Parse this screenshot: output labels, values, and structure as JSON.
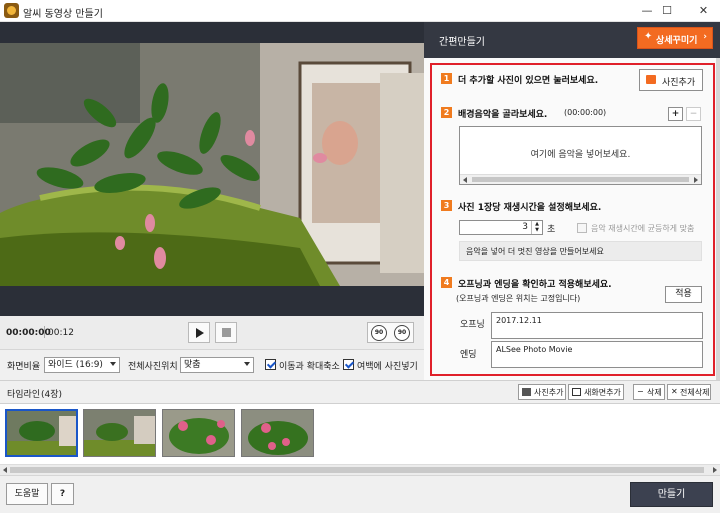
{
  "window": {
    "title": "알씨 동영상 만들기",
    "controls": [
      "—",
      "☐",
      "✕"
    ]
  },
  "player": {
    "current_time": "00:00:00",
    "total_time": "00:12",
    "rotate_left": "90",
    "rotate_right": "90"
  },
  "options": {
    "aspect_label": "화면비율",
    "aspect_value": "와이드 (16:9)",
    "position_label": "전체사진위치",
    "position_value": "맞춤",
    "motion_label": "이동과 확대축소",
    "margin_label": "여백에 사진넣기",
    "motion_checked": true,
    "margin_checked": true
  },
  "panel": {
    "title": "간편만들기",
    "detail_button": "상세꾸미기",
    "step1": {
      "num": "1",
      "text": "더 추가할 사진이 있으면 눌러보세요.",
      "button": "사진추가"
    },
    "step2": {
      "num": "2",
      "text": "배경음악을 골라보세요.",
      "time": "(00:00:00)",
      "plus": "+",
      "minus": "−",
      "placeholder": "여기에 음악을 넣어보세요."
    },
    "step3": {
      "num": "3",
      "text": "사진 1장당 재생시간을 설정해보세요.",
      "seconds": "3",
      "unit": "초",
      "fit_music": "음악 재생시간에 균등하게 맞춤",
      "hint": "음악을 넣어 더 멋진 영상을 만들어보세요"
    },
    "step4": {
      "num": "4",
      "text": "오프닝과 엔딩을 확인하고 적용해보세요.",
      "note": "(오프닝과 엔딩은 위치는 고정입니다)",
      "apply": "적용",
      "opening_label": "오프닝",
      "opening_value": "2017.12.11",
      "ending_label": "엔딩",
      "ending_value": "ALSee Photo Movie"
    }
  },
  "timeline": {
    "title": "타임라인",
    "count": "(4장)",
    "add_photo": "사진추가",
    "new_scene": "새화면추가",
    "delete": "삭제",
    "delete_all": "전체삭제",
    "delete_icon": "−",
    "delete_all_icon": "✕"
  },
  "footer": {
    "help": "도움말",
    "question": "?",
    "make": "만들기"
  },
  "colors": {
    "accent": "#f36b21",
    "dark": "#343842",
    "highlight": "#e0202a",
    "selection": "#1a56c8"
  }
}
